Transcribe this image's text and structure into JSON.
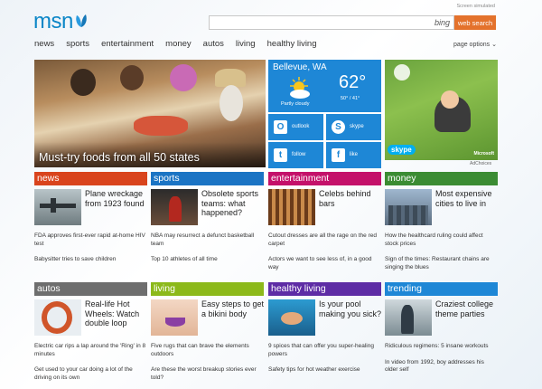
{
  "header": {
    "logo_text": "msn",
    "screen_link": "Screen simulated",
    "search_placeholder": "",
    "bing_label": "bing",
    "search_button": "web search",
    "nav": [
      "news",
      "sports",
      "entertainment",
      "money",
      "autos",
      "living",
      "healthy living"
    ],
    "page_options": "page options",
    "accent": "#e4722c"
  },
  "hero": {
    "caption": "Must-try foods from all 50 states"
  },
  "weather": {
    "city": "Bellevue, WA",
    "temp": "62°",
    "hilo": "50° / 41°",
    "condition": "Partly cloudy",
    "icon": "sun-cloud-icon",
    "color": "#1e87d6"
  },
  "social": [
    {
      "label": "outlook",
      "icon": "outlook-icon",
      "glyph": "O"
    },
    {
      "label": "skype",
      "icon": "skype-icon",
      "glyph": "S"
    },
    {
      "label": "follow",
      "icon": "twitter-icon",
      "glyph": "t"
    },
    {
      "label": "like",
      "icon": "facebook-icon",
      "glyph": "f"
    }
  ],
  "ad": {
    "brand": "skype",
    "advertiser": "Microsoft",
    "adchoices": "AdChoices"
  },
  "sections": [
    {
      "id": "news",
      "label": "news",
      "color": "#d9441d",
      "lead": "Plane wreckage from 1923 found",
      "items": [
        "FDA approves first-ever rapid at-home HIV test",
        "Babysitter tries to save children"
      ]
    },
    {
      "id": "sports",
      "label": "sports",
      "color": "#1b74c4",
      "lead": "Obsolete sports teams: what happened?",
      "items": [
        "NBA may resurrect a defunct basketball team",
        "Top 10 athletes of all time"
      ]
    },
    {
      "id": "entertainment",
      "label": "entertainment",
      "color": "#c4116a",
      "lead": "Celebs behind bars",
      "items": [
        "Cutout dresses are all the rage on the red carpet",
        "Actors we want to see less of, in a good way"
      ]
    },
    {
      "id": "money",
      "label": "money",
      "color": "#3b8c33",
      "lead": "Most expensive cities to live in",
      "items": [
        "How the healthcard ruling could affect stock prices",
        "Sign of the times: Restaurant chains are singing the blues"
      ]
    },
    {
      "id": "autos",
      "label": "autos",
      "color": "#6e6e6e",
      "lead": "Real-life Hot Wheels: Watch double loop",
      "items": [
        "Electric car rips a lap around the 'Ring' in 8 minutes",
        "Get used to your car doing a lot of the driving on its own"
      ]
    },
    {
      "id": "living",
      "label": "living",
      "color": "#8cb91a",
      "lead": "Easy steps to get a bikini body",
      "items": [
        "Five rugs that can brave the elements outdoors",
        "Are these the worst breakup stories ever told?"
      ]
    },
    {
      "id": "healthy-living",
      "label": "healthy living",
      "color": "#5e2ca5",
      "lead": "Is your pool making you sick?",
      "items": [
        "9 spices that can offer you super-healing powers",
        "Safety tips for hot weather exercise"
      ]
    },
    {
      "id": "trending",
      "label": "trending",
      "color": "#1e87d6",
      "lead": "Craziest college theme parties",
      "items": [
        "Ridiculous regimens: 5 insane workouts",
        "In video from 1992, boy addresses his older self"
      ]
    }
  ]
}
